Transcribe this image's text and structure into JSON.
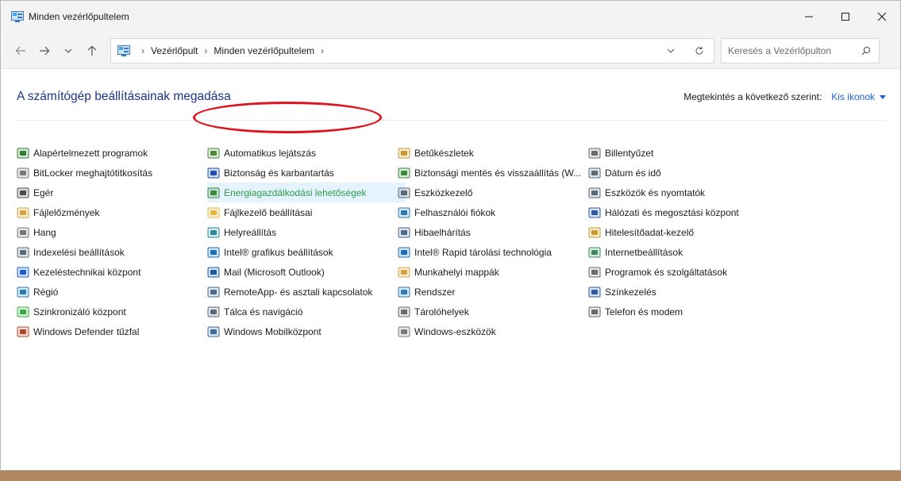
{
  "window": {
    "title": "Minden vezérlőpultelem"
  },
  "address": {
    "crumbs": [
      "Vezérlőpult",
      "Minden vezérlőpultelem"
    ]
  },
  "search": {
    "placeholder": "Keresés a Vezérlőpulton"
  },
  "header": {
    "title": "A számítógép beállításainak megadása",
    "view_by_label": "Megtekintés a következő szerint:",
    "view_by_value": "Kis ikonok"
  },
  "items": [
    {
      "label": "Alapértelmezett programok",
      "icon": "default-programs-icon",
      "color": "#2e7d32"
    },
    {
      "label": "BitLocker meghajtótitkosítás",
      "icon": "bitlocker-icon",
      "color": "#7a7a7a"
    },
    {
      "label": "Egér",
      "icon": "mouse-icon",
      "color": "#4a4a4a"
    },
    {
      "label": "Fájlelőzmények",
      "icon": "file-history-icon",
      "color": "#d8a23a"
    },
    {
      "label": "Hang",
      "icon": "speaker-icon",
      "color": "#777777"
    },
    {
      "label": "Indexelési beállítások",
      "icon": "indexing-icon",
      "color": "#5a6b7a"
    },
    {
      "label": "Kezeléstechnikai központ",
      "icon": "ease-of-access-icon",
      "color": "#1c5fd1"
    },
    {
      "label": "Régió",
      "icon": "region-icon",
      "color": "#2a7ab8"
    },
    {
      "label": "Szinkronizáló központ",
      "icon": "sync-icon",
      "color": "#3aa846"
    },
    {
      "label": "Windows Defender tűzfal",
      "icon": "firewall-icon",
      "color": "#b5472b"
    },
    {
      "label": "Automatikus lejátszás",
      "icon": "autoplay-icon",
      "color": "#4a8a3a"
    },
    {
      "label": "Biztonság és karbantartás",
      "icon": "flag-icon",
      "color": "#1c4fb8"
    },
    {
      "label": "Energiagazdálkodási lehetőségek",
      "icon": "power-options-icon",
      "color": "#3a8a3a"
    },
    {
      "label": "Fájlkezelő beállításai",
      "icon": "folder-options-icon",
      "color": "#e6b83a"
    },
    {
      "label": "Helyreállítás",
      "icon": "recovery-icon",
      "color": "#2a8a9a"
    },
    {
      "label": "Intel® grafikus beállítások",
      "icon": "intel-graphics-icon",
      "color": "#1a6fc0"
    },
    {
      "label": "Mail (Microsoft Outlook)",
      "icon": "mail-icon",
      "color": "#1a5aa8"
    },
    {
      "label": "RemoteApp- és asztali kapcsolatok",
      "icon": "remote-desktop-icon",
      "color": "#4a6a8a"
    },
    {
      "label": "Tálca és navigáció",
      "icon": "taskbar-icon",
      "color": "#5a6a7a"
    },
    {
      "label": "Windows Mobilközpont",
      "icon": "mobility-center-icon",
      "color": "#3a6a9a"
    },
    {
      "label": "Betűkészletek",
      "icon": "fonts-icon",
      "color": "#c89a2a"
    },
    {
      "label": "Biztonsági mentés és visszaállítás (W...",
      "icon": "backup-icon",
      "color": "#3a8a3a"
    },
    {
      "label": "Eszközkezelő",
      "icon": "device-manager-icon",
      "color": "#5a6a7a"
    },
    {
      "label": "Felhasználói fiókok",
      "icon": "user-accounts-icon",
      "color": "#2a7ab8"
    },
    {
      "label": "Hibaelhárítás",
      "icon": "troubleshooting-icon",
      "color": "#4a6a8a"
    },
    {
      "label": "Intel® Rapid tárolási technológia",
      "icon": "intel-rst-icon",
      "color": "#1a6fc0"
    },
    {
      "label": "Munkahelyi mappák",
      "icon": "work-folders-icon",
      "color": "#d8a23a"
    },
    {
      "label": "Rendszer",
      "icon": "system-icon",
      "color": "#2a7ab8"
    },
    {
      "label": "Tárolóhelyek",
      "icon": "storage-spaces-icon",
      "color": "#6a6a6a"
    },
    {
      "label": "Windows-eszközök",
      "icon": "windows-tools-icon",
      "color": "#7a7a7a"
    },
    {
      "label": "Billentyűzet",
      "icon": "keyboard-icon",
      "color": "#6a6a6a"
    },
    {
      "label": "Dátum és idő",
      "icon": "date-time-icon",
      "color": "#5a6a7a"
    },
    {
      "label": "Eszközök és nyomtatók",
      "icon": "printer-icon",
      "color": "#5a6a7a"
    },
    {
      "label": "Hálózati és megosztási központ",
      "icon": "network-icon",
      "color": "#2a5aa8"
    },
    {
      "label": "Hitelesítőadat-kezelő",
      "icon": "credential-manager-icon",
      "color": "#c89a2a"
    },
    {
      "label": "Internetbeállítások",
      "icon": "internet-options-icon",
      "color": "#3a8a5a"
    },
    {
      "label": "Programok és szolgáltatások",
      "icon": "programs-features-icon",
      "color": "#6a6a6a"
    },
    {
      "label": "Színkezelés",
      "icon": "color-management-icon",
      "color": "#2a5aa8"
    },
    {
      "label": "Telefon és modem",
      "icon": "phone-modem-icon",
      "color": "#6a6a6a"
    }
  ],
  "highlighted_item": "Energiagazdálkodási lehetőségek",
  "colors": {
    "title_blue": "#1e3287",
    "link_blue": "#1c5fd1",
    "annotation_red": "#e0141e",
    "hover_green": "#2a9d45"
  }
}
